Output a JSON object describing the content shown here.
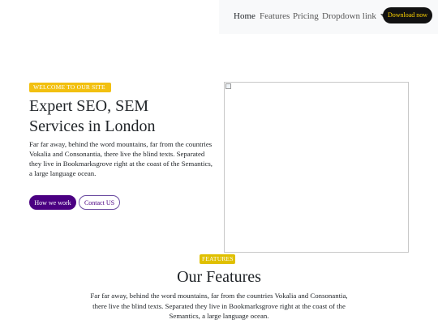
{
  "nav": {
    "items": [
      {
        "label": "Home"
      },
      {
        "label": "Features"
      },
      {
        "label": "Pricing"
      },
      {
        "label": "Dropdown link"
      }
    ],
    "download_label": "Download now"
  },
  "hero": {
    "badge": "WELCOME TO OUR SITE",
    "title_line1": "Expert SEO, SEM",
    "title_line2": "Services in London",
    "text": "Far far away, behind the word mountains, far from the countries Vokalia and Consonantia, there live the blind texts. Separated they live in Bookmarksgrove right at the coast of the Semantics, a large language ocean.",
    "primary_button": "How we work",
    "secondary_button": "Contact US"
  },
  "features": {
    "badge": "FEATURES",
    "title": "Our Features",
    "text": "Far far away, behind the word mountains, far from the countries Vokalia and Consonantia, there live the blind texts. Separated they live in Bookmarksgrove right at the coast of the Semantics, a large language ocean."
  },
  "colors": {
    "accent": "#4b0082",
    "badge": "#f2c010",
    "navbar_bg": "#f8f9fa",
    "download_bg": "#111111",
    "download_text": "#ffd400"
  },
  "icons": [
    "caret-down-icon",
    "broken-image-icon"
  ]
}
